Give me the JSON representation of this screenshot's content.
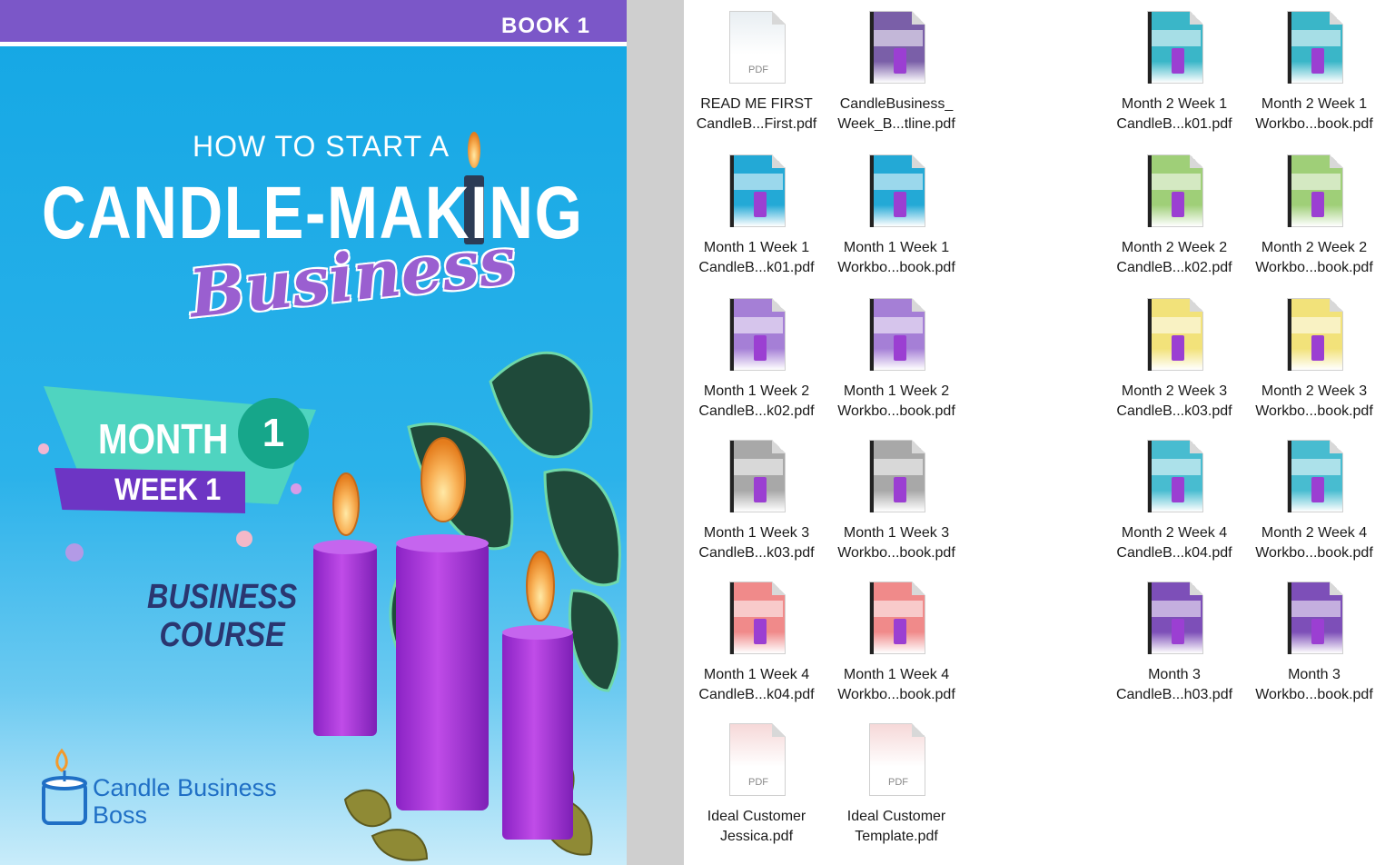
{
  "cover": {
    "book_label": "BOOK 1",
    "title_small": "HOW TO START A",
    "title_big": "CANDLE-MAKING",
    "title_script": "Business",
    "month_label": "MONTH",
    "month_number": "1",
    "week_label": "WEEK 1",
    "course_line1": "BUSINESS",
    "course_line2": "COURSE",
    "brand_line1": "Candle Business",
    "brand_line2": "Boss",
    "colors": {
      "sky": "#14a7e4",
      "purple": "#7b57c8",
      "teal": "#4fd4c0",
      "candle": "#a331d6"
    }
  },
  "files": [
    {
      "line1": "READ ME FIRST",
      "line2": "CandleB...First.pdf",
      "icon": "pdf-document-icon",
      "color": "#e8eef2",
      "tag": "PDF"
    },
    {
      "line1": "CandleBusiness_",
      "line2": "Week_B...tline.pdf",
      "icon": "workbook-cover-icon",
      "color": "#7a5fa8",
      "tag": ""
    },
    {
      "line1": "Month 2 Week 1",
      "line2": "CandleB...k01.pdf",
      "icon": "workbook-cover-icon",
      "color": "#3ab6c8",
      "tag": ""
    },
    {
      "line1": "Month 2 Week 1",
      "line2": "Workbo...book.pdf",
      "icon": "workbook-cover-icon",
      "color": "#3ab6c8",
      "tag": ""
    },
    {
      "line1": "Month 1 Week 1",
      "line2": "CandleB...k01.pdf",
      "icon": "workbook-cover-icon",
      "color": "#23a9d6",
      "tag": ""
    },
    {
      "line1": "Month 1 Week 1",
      "line2": "Workbo...book.pdf",
      "icon": "workbook-cover-icon",
      "color": "#23a9d6",
      "tag": ""
    },
    {
      "line1": "Month 2 Week 2",
      "line2": "CandleB...k02.pdf",
      "icon": "workbook-cover-icon",
      "color": "#9fcf78",
      "tag": ""
    },
    {
      "line1": "Month 2 Week 2",
      "line2": "Workbo...book.pdf",
      "icon": "workbook-cover-icon",
      "color": "#9fcf78",
      "tag": ""
    },
    {
      "line1": "Month 1 Week 2",
      "line2": "CandleB...k02.pdf",
      "icon": "workbook-cover-icon",
      "color": "#a57fd6",
      "tag": ""
    },
    {
      "line1": "Month 1 Week 2",
      "line2": "Workbo...book.pdf",
      "icon": "workbook-cover-icon",
      "color": "#a57fd6",
      "tag": ""
    },
    {
      "line1": "Month 2 Week 3",
      "line2": "CandleB...k03.pdf",
      "icon": "workbook-cover-icon",
      "color": "#f2e27a",
      "tag": ""
    },
    {
      "line1": "Month 2 Week 3",
      "line2": "Workbo...book.pdf",
      "icon": "workbook-cover-icon",
      "color": "#f2e27a",
      "tag": ""
    },
    {
      "line1": "Month 1 Week 3",
      "line2": "CandleB...k03.pdf",
      "icon": "workbook-cover-icon",
      "color": "#a8a8a8",
      "tag": ""
    },
    {
      "line1": "Month 1 Week 3",
      "line2": "Workbo...book.pdf",
      "icon": "workbook-cover-icon",
      "color": "#a8a8a8",
      "tag": ""
    },
    {
      "line1": "Month 2 Week 4",
      "line2": "CandleB...k04.pdf",
      "icon": "workbook-cover-icon",
      "color": "#48bcd0",
      "tag": ""
    },
    {
      "line1": "Month 2 Week 4",
      "line2": "Workbo...book.pdf",
      "icon": "workbook-cover-icon",
      "color": "#48bcd0",
      "tag": ""
    },
    {
      "line1": "Month 1 Week 4",
      "line2": "CandleB...k04.pdf",
      "icon": "workbook-cover-icon",
      "color": "#f08a8a",
      "tag": ""
    },
    {
      "line1": "Month 1 Week 4",
      "line2": "Workbo...book.pdf",
      "icon": "workbook-cover-icon",
      "color": "#f08a8a",
      "tag": ""
    },
    {
      "line1": "Month 3",
      "line2": "CandleB...h03.pdf",
      "icon": "workbook-cover-icon",
      "color": "#7d4fb8",
      "tag": ""
    },
    {
      "line1": "Month 3",
      "line2": "Workbo...book.pdf",
      "icon": "workbook-cover-icon",
      "color": "#7d4fb8",
      "tag": ""
    },
    {
      "line1": "Ideal Customer",
      "line2": "Jessica.pdf",
      "icon": "pdf-document-icon",
      "color": "#f6d8d8",
      "tag": "PDF"
    },
    {
      "line1": "Ideal Customer",
      "line2": "Template.pdf",
      "icon": "pdf-document-icon",
      "color": "#f6d8d8",
      "tag": "PDF"
    }
  ]
}
